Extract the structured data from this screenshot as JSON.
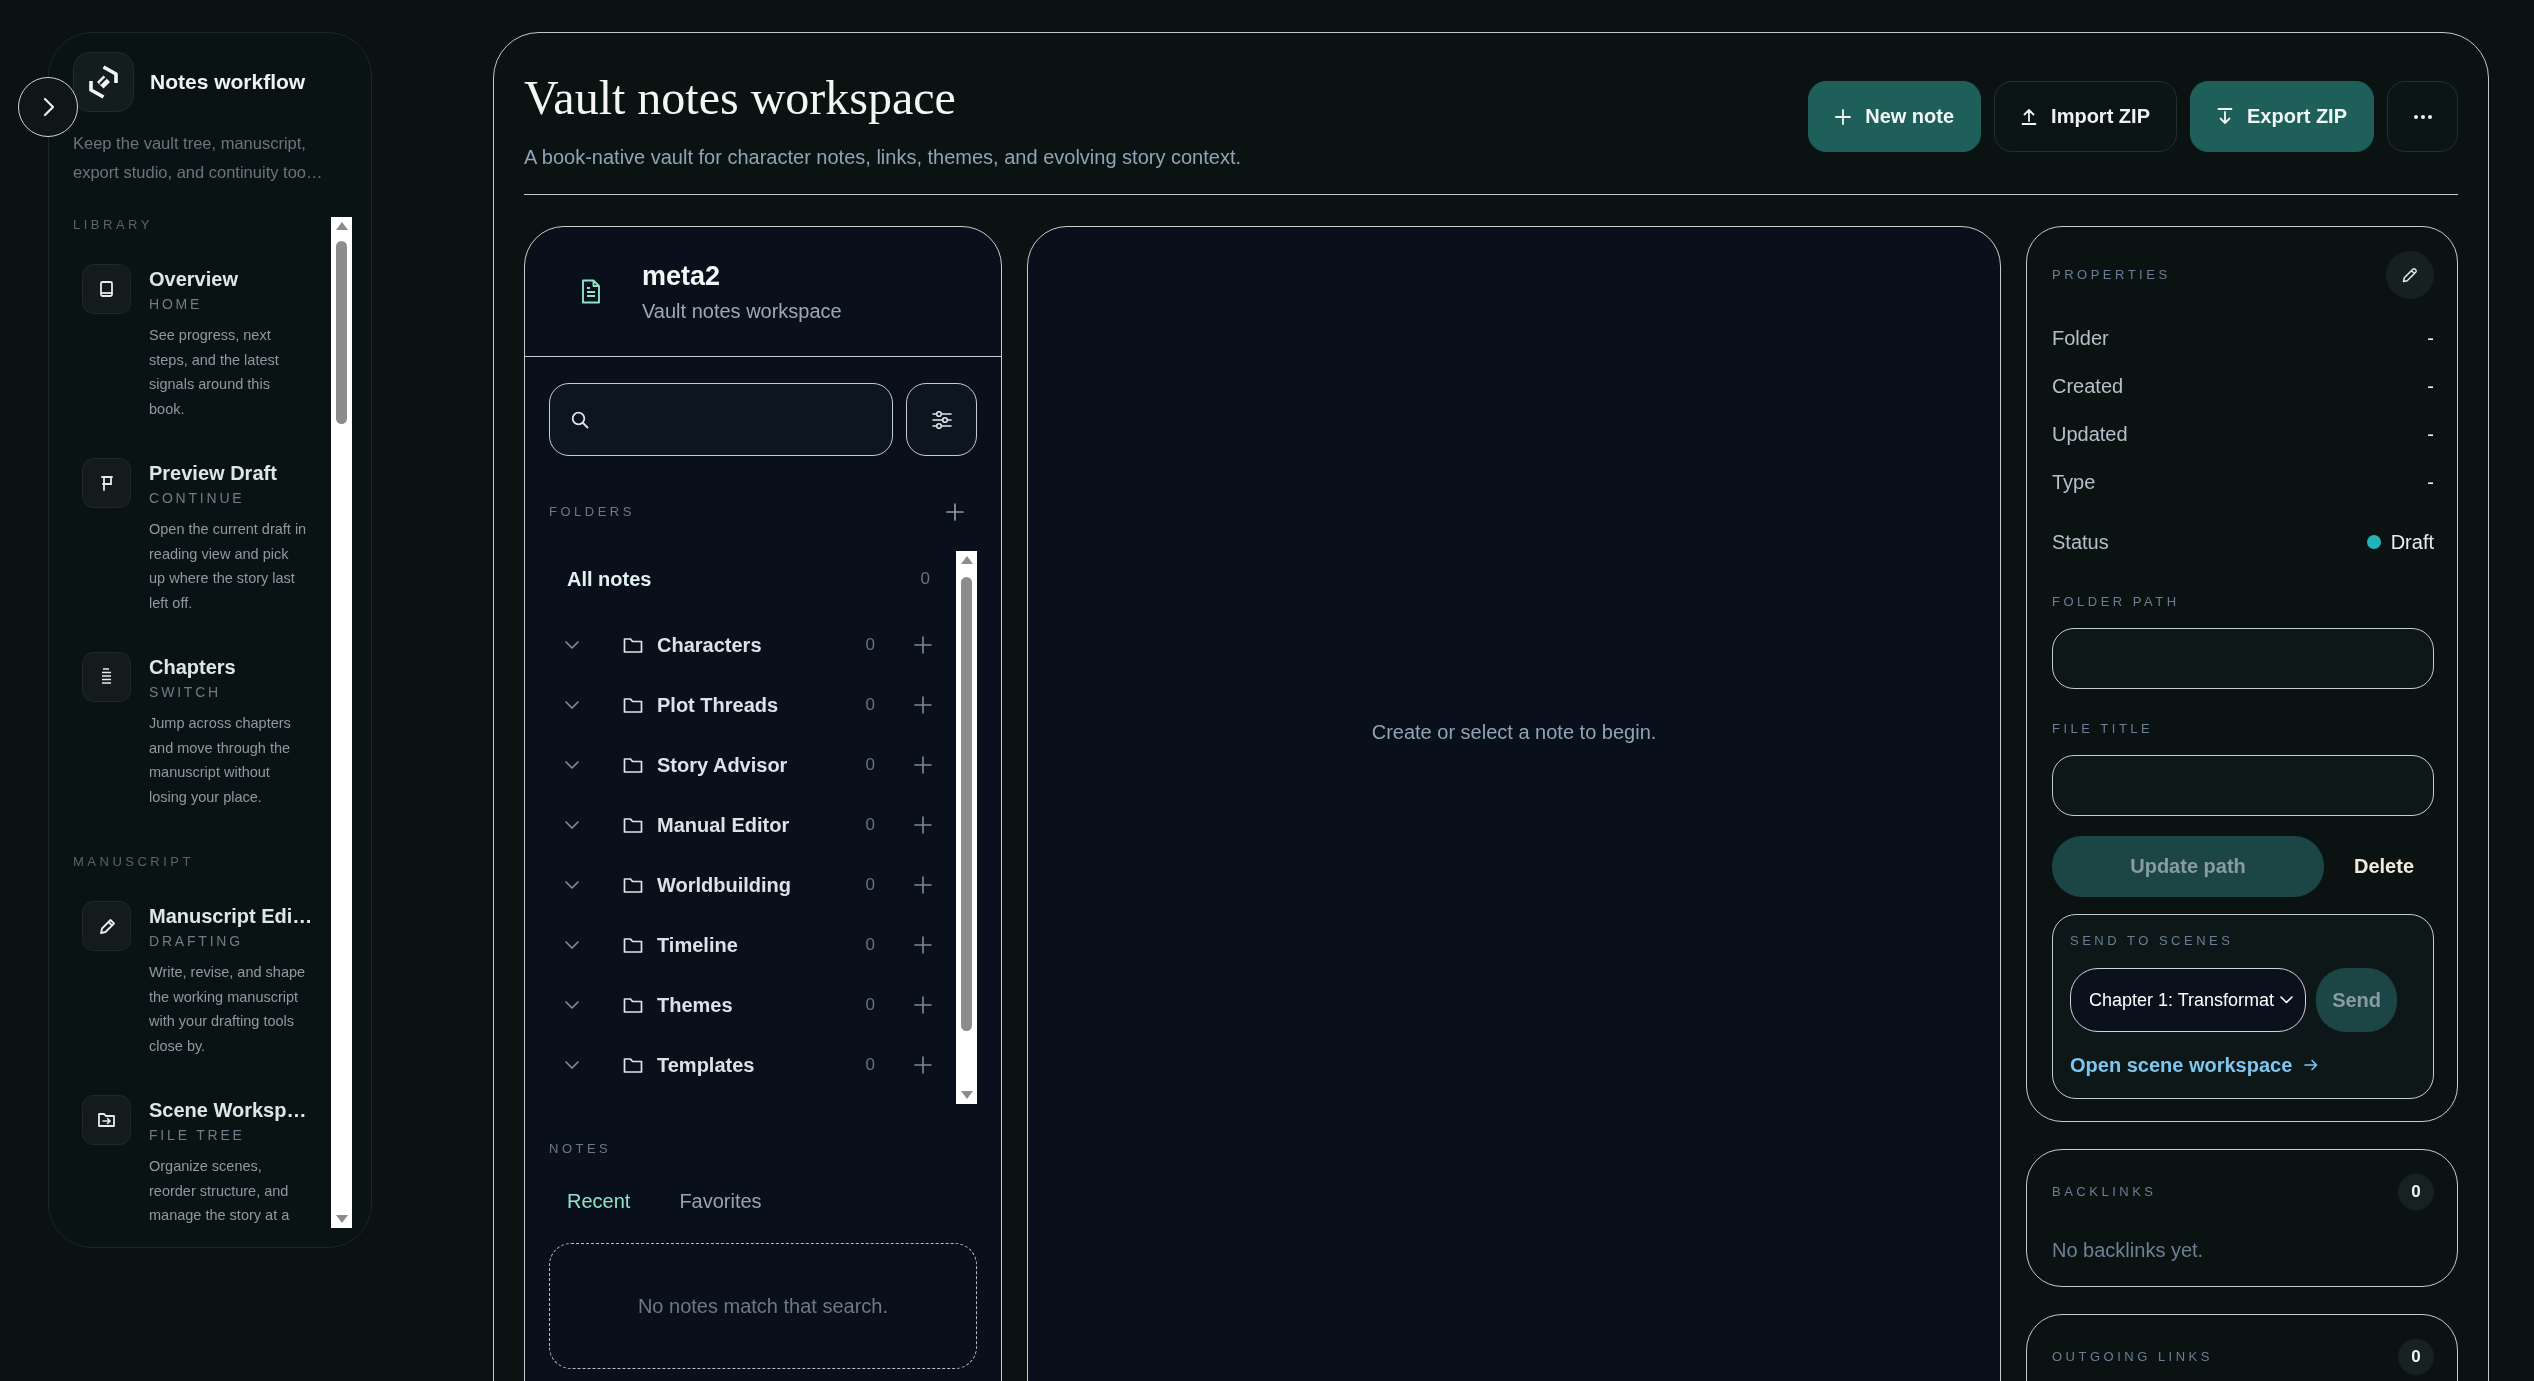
{
  "sidebar": {
    "title": "Notes workflow",
    "description": "Keep the vault tree, manuscript, export studio, and continuity too…",
    "sections": [
      {
        "label": "LIBRARY",
        "items": [
          {
            "title": "Overview",
            "tag": "HOME",
            "description": "See progress, next steps, and the latest signals around this book."
          },
          {
            "title": "Preview Draft",
            "tag": "CONTINUE",
            "description": "Open the current draft in reading view and pick up where the story last left off."
          },
          {
            "title": "Chapters",
            "tag": "SWITCH",
            "description": "Jump across chapters and move through the manuscript without losing your place."
          }
        ]
      },
      {
        "label": "MANUSCRIPT",
        "items": [
          {
            "title": "Manuscript Edi…",
            "tag": "DRAFTING",
            "description": "Write, revise, and shape the working manuscript with your drafting tools close by."
          },
          {
            "title": "Scene Worksp…",
            "tag": "FILE TREE",
            "description": "Organize scenes, reorder structure, and manage the story at a"
          }
        ]
      }
    ]
  },
  "header": {
    "title": "Vault notes workspace",
    "subtitle": "A book-native vault for character notes, links, themes, and evolving story context.",
    "actions": [
      {
        "label": "New note",
        "kind": "primary"
      },
      {
        "label": "Import ZIP",
        "kind": "secondary"
      },
      {
        "label": "Export ZIP",
        "kind": "primary"
      }
    ]
  },
  "vault": {
    "title": "meta2",
    "subtitle": "Vault notes workspace",
    "folders": {
      "label": "FOLDERS",
      "all_notes": {
        "label": "All notes",
        "count": "0"
      },
      "items": [
        {
          "name": "Characters",
          "count": "0"
        },
        {
          "name": "Plot Threads",
          "count": "0"
        },
        {
          "name": "Story Advisor",
          "count": "0"
        },
        {
          "name": "Manual Editor",
          "count": "0"
        },
        {
          "name": "Worldbuilding",
          "count": "0"
        },
        {
          "name": "Timeline",
          "count": "0"
        },
        {
          "name": "Themes",
          "count": "0"
        },
        {
          "name": "Templates",
          "count": "0"
        }
      ]
    },
    "notes": {
      "label": "NOTES",
      "tabs": [
        {
          "label": "Recent",
          "selected": true
        },
        {
          "label": "Favorites",
          "selected": false
        }
      ],
      "empty_message": "No notes match that search."
    }
  },
  "editor": {
    "empty_message": "Create or select a note to begin."
  },
  "properties": {
    "label": "PROPERTIES",
    "rows": [
      {
        "name": "Folder",
        "value": "-"
      },
      {
        "name": "Created",
        "value": "-"
      },
      {
        "name": "Updated",
        "value": "-"
      },
      {
        "name": "Type",
        "value": "-"
      },
      {
        "name": "Status",
        "value": "Draft",
        "color": "#22b5b8"
      }
    ],
    "folder_path": {
      "label": "FOLDER PATH"
    },
    "file_title": {
      "label": "FILE TITLE"
    },
    "update_button": {
      "label": "Update path",
      "disabled": true
    },
    "delete_button": {
      "label": "Delete"
    },
    "send_to_scenes": {
      "label": "SEND TO SCENES",
      "scene_select": {
        "value": "Chapter 1: Transformat"
      },
      "send_button": {
        "label": "Send",
        "disabled": true
      },
      "link": "Open scene workspace"
    }
  },
  "backlinks": {
    "label": "BACKLINKS",
    "count": "0",
    "empty_message": "No backlinks yet."
  },
  "outgoing_links": {
    "label": "OUTGOING LINKS",
    "count": "0"
  }
}
